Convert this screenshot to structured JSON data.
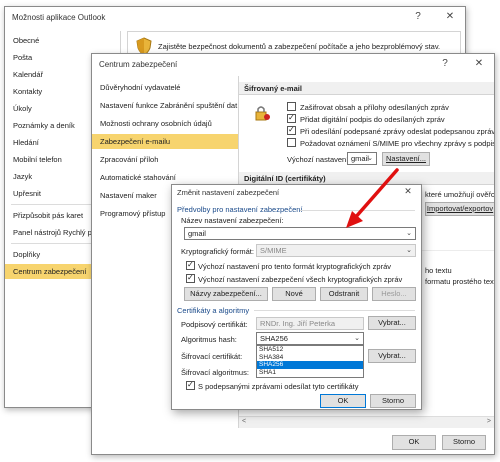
{
  "back": {
    "title": "Možnosti aplikace Outlook",
    "help": "?",
    "close": "✕",
    "banner": "Zajistěte bezpečnost dokumentů a zabezpečení počítače a jeho bezproblémový stav.",
    "nav": [
      "Obecné",
      "Pošta",
      "Kalendář",
      "Kontakty",
      "Úkoly",
      "Poznámky a deník",
      "Hledání",
      "Mobilní telefon",
      "Jazyk",
      "Upřesnit",
      "Přizpůsobit pás karet",
      "Panel nástrojů Rychlý př",
      "Doplňky",
      "Centrum zabezpečení"
    ],
    "selected_index": 13
  },
  "trust": {
    "title": "Centrum zabezpečení",
    "help": "?",
    "close": "✕",
    "nav": [
      "Důvěryhodní vydavatelé",
      "Nastavení funkce Zabránění spuštění dat",
      "Možnosti ochrany osobních údajů",
      "Zabezpečení e-mailu",
      "Zpracování příloh",
      "Automatické stahování",
      "Nastavení maker",
      "Programový přístup"
    ],
    "selected_index": 3,
    "encrypted_header": "Šifrovaný e-mail",
    "opts": [
      {
        "label": "Zašifrovat obsah a přílohy odesílaných zpráv",
        "checked": false
      },
      {
        "label": "Přidat digitální podpis do odesílaných zpráv",
        "checked": true
      },
      {
        "label": "Při odesílání podepsané zprávy odeslat podepsanou zprávu b",
        "checked": true
      },
      {
        "label": "Požadovat oznámení S/MIME pro všechny zprávy s podpisem S",
        "checked": false
      }
    ],
    "default_label": "Výchozí nastavení:",
    "default_value": "gmail",
    "settings_btn": "Nastavení...",
    "digital_id_header": "Digitální ID (certifikáty)",
    "id_text_partial": "které umožňují ověřova",
    "import_btn": "Importovat/exportov",
    "text_label": "ho textu",
    "text_sub": "formatu prostého text",
    "ok": "OK",
    "cancel": "Storno"
  },
  "dialog": {
    "title": "Změnit nastavení zabezpečení",
    "close": "✕",
    "prefs_group": "Předvolby pro nastavení zabezpečení",
    "name_label": "Název nastavení zabezpečení:",
    "name_value": "gmail",
    "crypto_label": "Kryptografický formát:",
    "crypto_value": "S/MIME",
    "chk1": "Výchozí nastavení pro tento formát kryptografických zpráv",
    "chk2": "Výchozí nastavení zabezpečení všech kryptografických zpráv",
    "btn_names": "Názvy zabezpečení...",
    "btn_new": "Nové",
    "btn_remove": "Odstranit",
    "btn_password": "Heslo...",
    "certs_group": "Certifikáty a algoritmy",
    "sign_cert_label": "Podpisový certifikát:",
    "sign_cert_value": "RNDr. Ing. Jiří Peterka",
    "choose_btn": "Vybrat...",
    "hash_label": "Algoritmus hash:",
    "hash_value": "SHA256",
    "hash_options": [
      "SHA512",
      "SHA384",
      "SHA256",
      "SHA1"
    ],
    "hash_selected_index": 2,
    "enc_cert_label": "Šifrovací certifikát:",
    "enc_alg_label": "Šifrovací algoritmus:",
    "chk3": "S podepsanými zprávami odesílat tyto certifikáty",
    "ok": "OK",
    "cancel": "Storno"
  },
  "colors": {
    "accent_selection": "#f7d46e",
    "arrow": "#e01010",
    "list_highlight": "#0078d7"
  }
}
